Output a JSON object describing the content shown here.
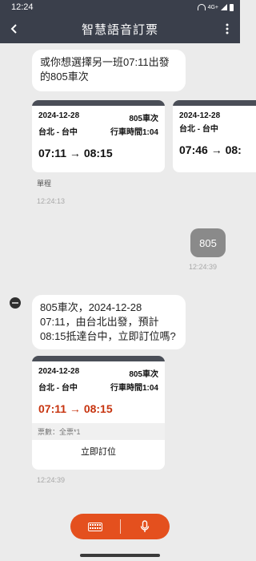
{
  "status_bar": {
    "time": "12:24",
    "network": "4G+"
  },
  "header": {
    "title": "智慧語音訂票"
  },
  "messages": {
    "bot_alternative": {
      "line1": "或你想選擇另一班07:11出發",
      "line2": "的805車次"
    },
    "cards_row": [
      {
        "date": "2024-12-28",
        "train_no": "805車次",
        "route": "台北 - 台中",
        "duration": "行車時間1:04",
        "times": "07:11 → 08:15"
      },
      {
        "date": "2024-12-28",
        "route": "台北 - 台中",
        "times": "07:46 → 08:"
      }
    ],
    "cards_caption": "單程",
    "timestamp_1": "12:24:13",
    "user_reply": "805",
    "timestamp_2": "12:24:39",
    "bot_confirm": {
      "line1": "805車次，2024-12-28",
      "line2": "07:11，由台北出發，預計",
      "line3": "08:15抵達台中，立即訂位嗎?"
    },
    "confirm_card": {
      "date": "2024-12-28",
      "train_no": "805車次",
      "route": "台北 - 台中",
      "duration": "行車時間1:04",
      "times": "07:11 → 08:15",
      "tickets": "票數：全票*1",
      "action": "立即訂位"
    },
    "timestamp_3": "12:24:39"
  },
  "colors": {
    "header_bg": "#3a3f4b",
    "accent": "#e4501e",
    "highlight_time": "#c7340f"
  }
}
